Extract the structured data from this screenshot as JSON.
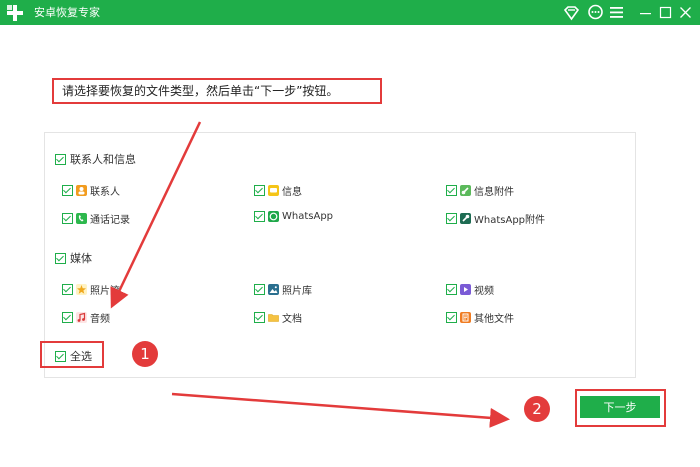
{
  "titlebar": {
    "title": "安卓恢复专家"
  },
  "instruction": "请选择要恢复的文件类型，然后单击“下一步”按钮。",
  "groups": [
    {
      "label": "联系人和信息",
      "items": [
        {
          "label": "联系人",
          "icon": "contacts-icon"
        },
        {
          "label": "信息",
          "icon": "message-icon"
        },
        {
          "label": "信息附件",
          "icon": "attachment-icon"
        },
        {
          "label": "通话记录",
          "icon": "phone-icon"
        },
        {
          "label": "WhatsApp",
          "icon": "whatsapp-icon"
        },
        {
          "label": "WhatsApp附件",
          "icon": "whatsapp-attachment-icon"
        }
      ]
    },
    {
      "label": "媒体",
      "items": [
        {
          "label": "照片流",
          "icon": "photostream-icon"
        },
        {
          "label": "照片库",
          "icon": "photo-library-icon"
        },
        {
          "label": "视频",
          "icon": "video-icon"
        },
        {
          "label": "音频",
          "icon": "audio-icon"
        },
        {
          "label": "文档",
          "icon": "folder-icon"
        },
        {
          "label": "其他文件",
          "icon": "other-files-icon"
        }
      ]
    }
  ],
  "select_all": "全选",
  "next_button": "下一步",
  "badges": [
    "1",
    "2"
  ],
  "colors": {
    "brand": "#1fae4a",
    "annotation": "#e33b3b"
  }
}
